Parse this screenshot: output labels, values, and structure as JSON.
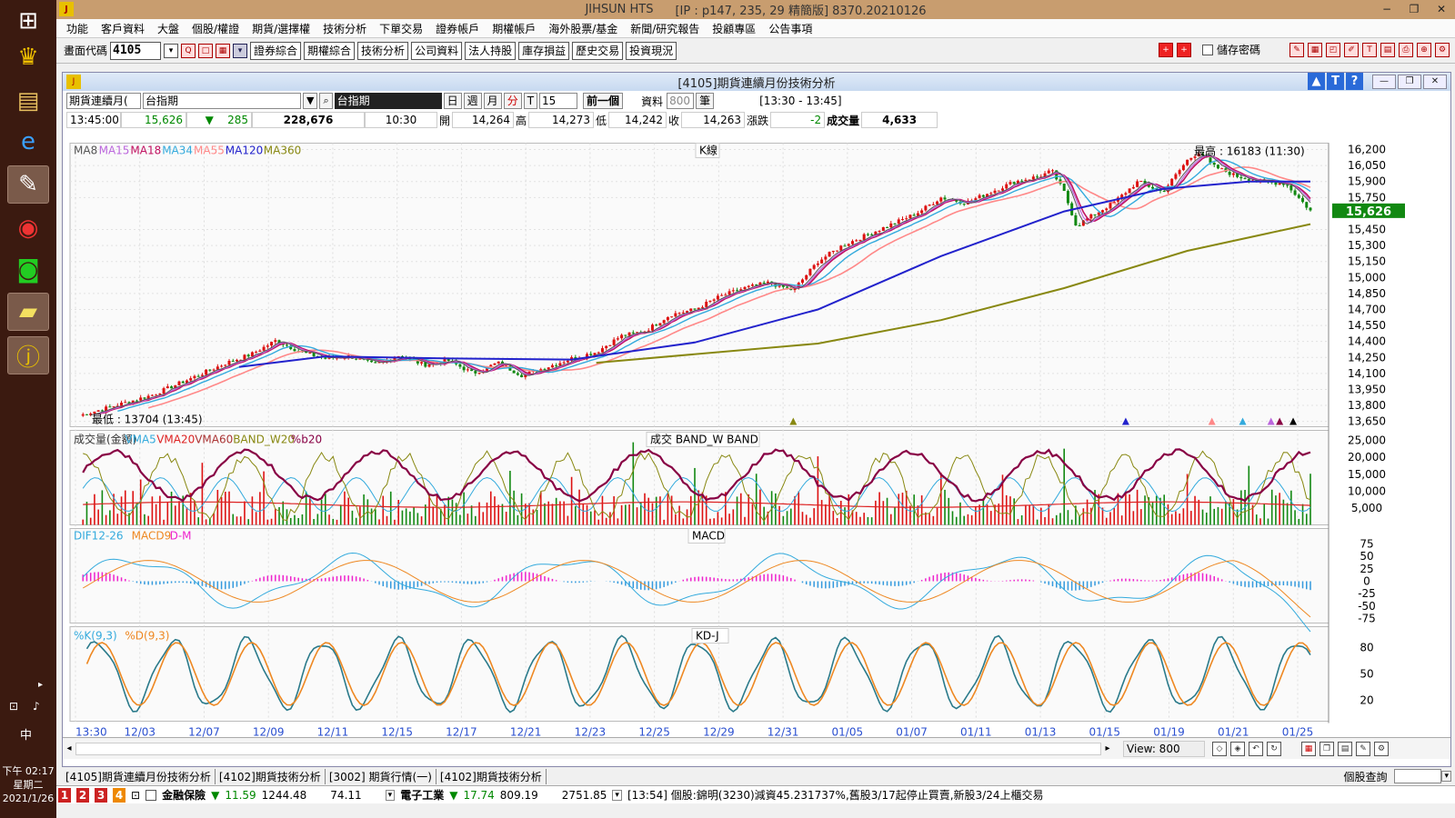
{
  "taskbar": {
    "icons": [
      "windows-icon",
      "crown-icon",
      "folder-icon",
      "ie-icon",
      "paint-icon",
      "chrome-icon",
      "line-icon",
      "notes-icon",
      "jihsun-icon"
    ],
    "time": "下午 02:17",
    "weekday": "星期二",
    "date": "2021/1/26",
    "ime": "中"
  },
  "window": {
    "title": "JIHSUN HTS",
    "subtitle": "[IP : p147, 235, 29 精簡版] 8370.20210126"
  },
  "menu": [
    "功能",
    "客戶資料",
    "大盤",
    "個股/權證",
    "期貨/選擇權",
    "技術分析",
    "下單交易",
    "證券帳戶",
    "期權帳戶",
    "海外股票/基金",
    "新聞/研究報告",
    "投顧專區",
    "公告事項"
  ],
  "toolbar": {
    "code_label": "畫面代碼",
    "code_value": "4105",
    "buttons": [
      "證券綜合",
      "期權綜合",
      "技術分析",
      "公司資料",
      "法人持股",
      "庫存損益",
      "歷史交易",
      "投資現況"
    ],
    "save_password": "儲存密碼"
  },
  "chart_window": {
    "title": "[4105]期貨連續月份技術分析",
    "mode_select": "期貨連續月(",
    "symbol_select": "台指期",
    "symbol_name": "台指期",
    "periods": [
      "日",
      "週",
      "月",
      "分",
      "T"
    ],
    "period_value": "15",
    "prev_label": "前一個",
    "data_label": "資料",
    "data_count": "800",
    "unit": "筆",
    "time_range": "[13:30 - 13:45]"
  },
  "quote": {
    "time": "13:45:00",
    "price": "15,626",
    "change": "285",
    "volume_total": "228,676",
    "bar_time": "10:30",
    "open_label": "開",
    "open": "14,264",
    "high_label": "高",
    "high": "14,273",
    "low_label": "低",
    "low": "14,242",
    "close_label": "收",
    "close": "14,263",
    "chg_label": "漲跌",
    "chg": "-2",
    "vol_label": "成交量",
    "vol": "4,633"
  },
  "panels": {
    "k": {
      "title": "K線",
      "legend": [
        "MA8",
        "MA15",
        "MA18",
        "MA34",
        "MA55",
        "MA120",
        "MA360"
      ],
      "legend_colors": [
        "#555555",
        "#bb66dd",
        "#c01060",
        "#33aadd",
        "#ff8888",
        "#2222cc",
        "#888811"
      ],
      "max_label": "最高 : 16183 (11:30)",
      "min_label": "最低 : 13704 (13:45)",
      "last_label": "15,626"
    },
    "vol": {
      "title": "成交  BAND_W  BAND",
      "legend": [
        "成交量(金額)",
        "VMA5",
        "VMA20",
        "VMA60",
        "BAND_W20",
        "%b20"
      ],
      "legend_colors": [
        "#333333",
        "#33aadd",
        "#dd2222",
        "#aa3333",
        "#888811",
        "#880044"
      ]
    },
    "macd": {
      "title": "MACD",
      "legend": [
        "DIF12-26",
        "MACD9",
        "D-M"
      ],
      "legend_colors": [
        "#33aadd",
        "#ee8822",
        "#ee22cc"
      ]
    },
    "kd": {
      "title": "KD-J",
      "legend": [
        "%K(9,3)",
        "%D(9,3)"
      ],
      "legend_colors": [
        "#33aadd",
        "#ee8822"
      ]
    }
  },
  "chart_data": {
    "type": "line",
    "x_labels": [
      "13:30",
      "12/03",
      "12/07",
      "12/09",
      "12/11",
      "12/15",
      "12/17",
      "12/21",
      "12/23",
      "12/25",
      "12/29",
      "12/31",
      "01/05",
      "01/07",
      "01/11",
      "01/13",
      "01/15",
      "01/19",
      "01/21",
      "01/25"
    ],
    "price_ticks": [
      16200,
      16050,
      15900,
      15750,
      15450,
      15300,
      15150,
      15000,
      14850,
      14700,
      14550,
      14400,
      14250,
      14100,
      13950,
      13800,
      13650
    ],
    "ylim": [
      13600,
      16260
    ],
    "vol_ticks": [
      25000,
      20000,
      15000,
      10000,
      5000
    ],
    "macd_ticks": [
      75,
      50,
      25,
      0,
      -25,
      -50,
      -75
    ],
    "kd_ticks": [
      80,
      50,
      20
    ],
    "price_path": [
      [
        0,
        13704
      ],
      [
        3,
        13800
      ],
      [
        6,
        13900
      ],
      [
        9,
        14050
      ],
      [
        12,
        14200
      ],
      [
        14,
        14280
      ],
      [
        16,
        14410
      ],
      [
        18,
        14300
      ],
      [
        20,
        14240
      ],
      [
        22,
        14260
      ],
      [
        24,
        14180
      ],
      [
        26,
        14270
      ],
      [
        28,
        14180
      ],
      [
        30,
        14220
      ],
      [
        32,
        14100
      ],
      [
        34,
        14200
      ],
      [
        36,
        14080
      ],
      [
        38,
        14160
      ],
      [
        40,
        14240
      ],
      [
        42,
        14300
      ],
      [
        44,
        14450
      ],
      [
        46,
        14500
      ],
      [
        48,
        14650
      ],
      [
        50,
        14700
      ],
      [
        52,
        14820
      ],
      [
        54,
        14900
      ],
      [
        56,
        14950
      ],
      [
        58,
        14880
      ],
      [
        60,
        15150
      ],
      [
        62,
        15300
      ],
      [
        64,
        15400
      ],
      [
        66,
        15500
      ],
      [
        68,
        15600
      ],
      [
        70,
        15750
      ],
      [
        72,
        15700
      ],
      [
        74,
        15800
      ],
      [
        76,
        15900
      ],
      [
        78,
        15950
      ],
      [
        79,
        16000
      ],
      [
        80,
        15800
      ],
      [
        81,
        15480
      ],
      [
        82,
        15560
      ],
      [
        84,
        15700
      ],
      [
        86,
        15900
      ],
      [
        88,
        15800
      ],
      [
        90,
        16100
      ],
      [
        91,
        16183
      ],
      [
        92,
        16050
      ],
      [
        94,
        15950
      ],
      [
        96,
        15900
      ],
      [
        98,
        15880
      ],
      [
        100,
        15626
      ]
    ],
    "ma120_path": [
      [
        13,
        14160
      ],
      [
        20,
        14260
      ],
      [
        30,
        14240
      ],
      [
        40,
        14230
      ],
      [
        50,
        14390
      ],
      [
        60,
        14700
      ],
      [
        70,
        15200
      ],
      [
        80,
        15620
      ],
      [
        88,
        15830
      ],
      [
        95,
        15900
      ],
      [
        100,
        15900
      ]
    ],
    "ma360_path": [
      [
        42,
        14200
      ],
      [
        60,
        14380
      ],
      [
        70,
        14600
      ],
      [
        80,
        14900
      ],
      [
        90,
        15250
      ],
      [
        100,
        15500
      ]
    ]
  },
  "bottom": {
    "view_label": "View: 800",
    "tabs": [
      "[4105]期貨連續月份技術分析",
      "[4102]期貨技術分析",
      "[3002]  期貨行情(一)",
      "[4102]期貨技術分析"
    ],
    "stock_query": "個股查詢"
  },
  "ticker": {
    "sector1": "金融保險",
    "s1_price": "11.59",
    "s1_val": "1244.48",
    "s1_chg": "74.11",
    "sector2": "電子工業",
    "s2_price": "17.74",
    "s2_val": "809.19",
    "s2_chg": "2751.85",
    "news": "[13:54]  個股:錦明(3230)減資45.231737%,舊股3/17起停止買賣,新股3/24上櫃交易"
  }
}
